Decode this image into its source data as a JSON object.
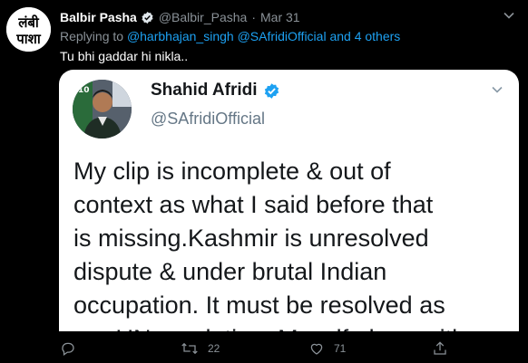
{
  "tweet": {
    "author_name": "Balbir Pasha",
    "author_handle": "@Balbir_Pasha",
    "separator": "·",
    "date": "Mar 31",
    "reply_prefix": "Replying to",
    "reply_to_1": "@harbhajan_singh",
    "reply_to_2": "@SAfridiOfficial",
    "reply_and": "and",
    "reply_others": "4 others",
    "text": "Tu bhi gaddar hi nikla..",
    "avatar_text_1": "लंबी",
    "avatar_text_2": "पाशा"
  },
  "quoted_image": {
    "name": "Shahid Afridi",
    "handle": "@SAfridiOfficial",
    "avatar_tag": "10",
    "lines": [
      "My clip is incomplete & out of",
      "context as what I said before that",
      "is missing.Kashmir is unresolved",
      "dispute & under brutal Indian",
      "occupation. It must be resolved as",
      "per UN resolution. Myself along with"
    ]
  },
  "actions": {
    "reply_icon": "comment-icon",
    "retweet_icon": "retweet-icon",
    "retweet_count": "22",
    "like_icon": "heart-icon",
    "like_count": "71",
    "share_icon": "share-icon"
  },
  "colors": {
    "background": "#000000",
    "link": "#1da1f2",
    "muted": "#8a9197",
    "verified": "#1da1f2"
  }
}
